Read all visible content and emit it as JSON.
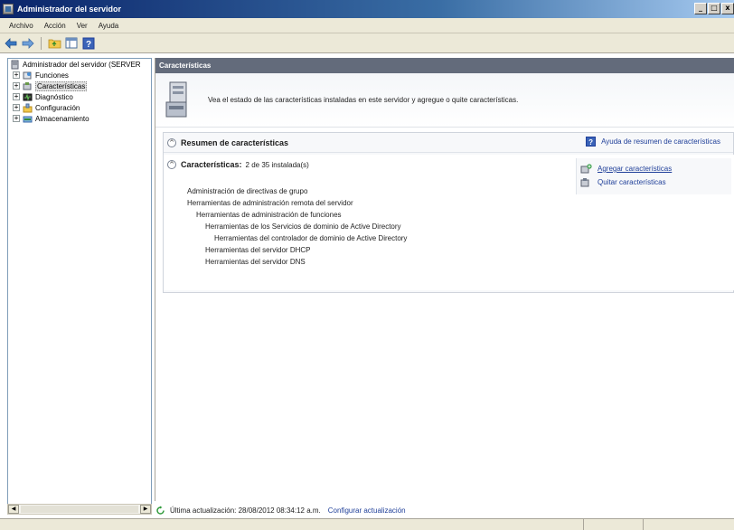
{
  "window": {
    "title": "Administrador del servidor",
    "buttons": [
      "_",
      "□",
      "x"
    ]
  },
  "menu": {
    "items": [
      "Archivo",
      "Acción",
      "Ver",
      "Ayuda"
    ]
  },
  "toolbar": {
    "icons": [
      "back-arrow-icon",
      "forward-arrow-icon",
      "up-folder-icon",
      "show-hide-console-tree-icon",
      "help-icon"
    ]
  },
  "tree": {
    "root": "Administrador del servidor (SERVER",
    "items": [
      {
        "label": "Funciones",
        "icon": "roles-icon"
      },
      {
        "label": "Características",
        "icon": "features-icon",
        "selected": true
      },
      {
        "label": "Diagnóstico",
        "icon": "diagnostics-icon"
      },
      {
        "label": "Configuración",
        "icon": "configuration-icon"
      },
      {
        "label": "Almacenamiento",
        "icon": "storage-icon"
      }
    ],
    "expander": "+"
  },
  "content": {
    "header": "Características",
    "intro": "Vea el estado de las características instaladas en este servidor y agregue o quite características.",
    "summary": {
      "title": "Resumen de características",
      "help_link": "Ayuda de resumen de características",
      "collapse_glyph": "^"
    },
    "features": {
      "title": "Características:",
      "count": "2 de 35 instalada(s)",
      "list": [
        "Administración de directivas de grupo",
        "Herramientas de administración remota del servidor",
        "Herramientas de administración de funciones",
        "Herramientas de los Servicios de dominio de Active Directory",
        "Herramientas del controlador de dominio de Active Directory",
        "Herramientas del servidor DHCP",
        "Herramientas del servidor DNS"
      ],
      "actions": {
        "add": "Agregar características",
        "remove": "Quitar características"
      }
    }
  },
  "status": {
    "last_update": "Última actualización: 28/08/2012 08:34:12 a.m.",
    "configure_link": "Configurar actualización"
  },
  "colors": {
    "header_bg": "#636b7b",
    "link": "#1f3f99",
    "chrome": "#ece9d8"
  }
}
